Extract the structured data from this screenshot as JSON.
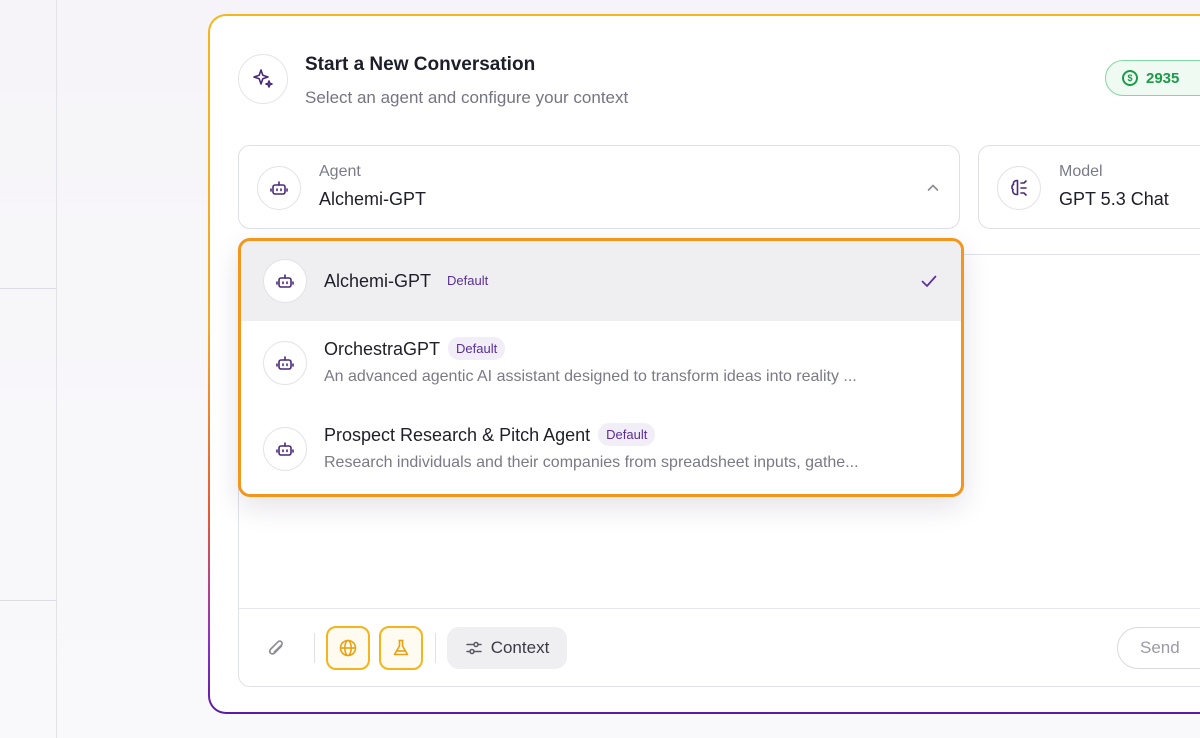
{
  "header": {
    "title": "Start a New Conversation",
    "subtitle": "Select an agent and configure your context",
    "credits": "2935",
    "credits_icon": "dollar-circle-icon",
    "icon": "sparkle-icon"
  },
  "agent_select": {
    "label": "Agent",
    "value": "Alchemi-GPT",
    "icon": "robot-icon",
    "expanded": true
  },
  "model_select": {
    "label": "Model",
    "value": "GPT 5.3 Chat",
    "icon": "brain-icon"
  },
  "dropdown": {
    "items": [
      {
        "name": "Alchemi-GPT",
        "badge": "Default",
        "description": "",
        "selected": true
      },
      {
        "name": "OrchestraGPT",
        "badge": "Default",
        "description": "An advanced agentic AI assistant designed to transform ideas into reality ...",
        "selected": false
      },
      {
        "name": "Prospect Research & Pitch Agent",
        "badge": "Default",
        "description": "Research individuals and their companies from spreadsheet inputs, gathe...",
        "selected": false
      }
    ]
  },
  "composer": {
    "context_label": "Context",
    "send_label": "Send"
  },
  "colors": {
    "accent_orange": "#f4951c",
    "accent_purple": "#5a2f9a",
    "credits_green": "#1e9a4b"
  }
}
